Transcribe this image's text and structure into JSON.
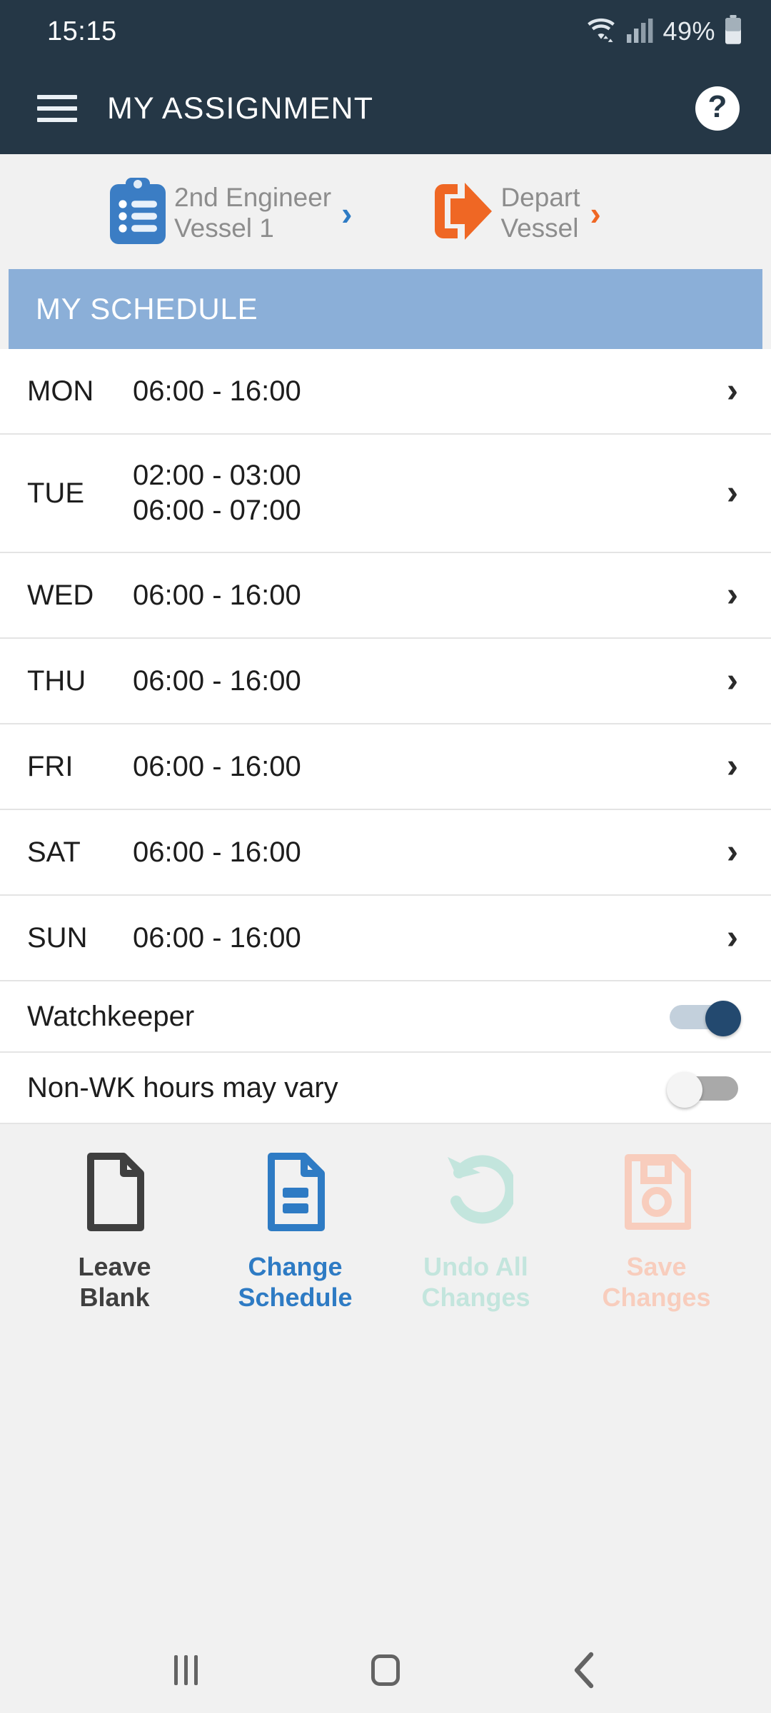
{
  "status_bar": {
    "time": "15:15",
    "battery_percent": "49%",
    "wifi_icon": "wifi-icon",
    "signal_icon": "signal-bars-icon",
    "battery_icon": "battery-icon"
  },
  "app_bar": {
    "menu_icon": "hamburger-menu-icon",
    "title": "MY ASSIGNMENT",
    "help_label": "?"
  },
  "assignment_actions": [
    {
      "icon": "clipboard-checklist-icon",
      "line1": "2nd Engineer",
      "line2": "Vessel 1",
      "chevron": "›",
      "color": "#2e7bc4"
    },
    {
      "icon": "depart-exit-icon",
      "line1": "Depart",
      "line2": "Vessel",
      "chevron": "›",
      "color": "#ef6724"
    }
  ],
  "schedule": {
    "header": "MY SCHEDULE",
    "header_color": "#8bafd8",
    "rows": [
      {
        "day": "MON",
        "times": [
          "06:00 - 16:00"
        ],
        "chevron": "›"
      },
      {
        "day": "TUE",
        "times": [
          "02:00 - 03:00",
          "06:00 - 07:00"
        ],
        "chevron": "›"
      },
      {
        "day": "WED",
        "times": [
          "06:00 - 16:00"
        ],
        "chevron": "›"
      },
      {
        "day": "THU",
        "times": [
          "06:00 - 16:00"
        ],
        "chevron": "›"
      },
      {
        "day": "FRI",
        "times": [
          "06:00 - 16:00"
        ],
        "chevron": "›"
      },
      {
        "day": "SAT",
        "times": [
          "06:00 - 16:00"
        ],
        "chevron": "›"
      },
      {
        "day": "SUN",
        "times": [
          "06:00 - 16:00"
        ],
        "chevron": "›"
      }
    ]
  },
  "toggles": [
    {
      "label": "Watchkeeper",
      "state": "on"
    },
    {
      "label": "Non-WK hours may vary",
      "state": "off"
    }
  ],
  "buttons": [
    {
      "icon": "blank-document-icon",
      "line1": "Leave",
      "line2": "Blank",
      "color": "#3f3f3f",
      "enabled": "true"
    },
    {
      "icon": "edit-document-icon",
      "line1": "Change",
      "line2": "Schedule",
      "color": "#2e7bc4",
      "enabled": "true"
    },
    {
      "icon": "undo-arrow-icon",
      "line1": "Undo All",
      "line2": "Changes",
      "color": "#c3e5dd",
      "enabled": "false"
    },
    {
      "icon": "save-floppy-icon",
      "line1": "Save",
      "line2": "Changes",
      "color": "#f8cdbd",
      "enabled": "false"
    }
  ],
  "nav_bar": {
    "recents_icon": "recents-icon",
    "home_icon": "home-icon",
    "back_icon": "back-chevron-icon",
    "back_glyph": "‹"
  }
}
